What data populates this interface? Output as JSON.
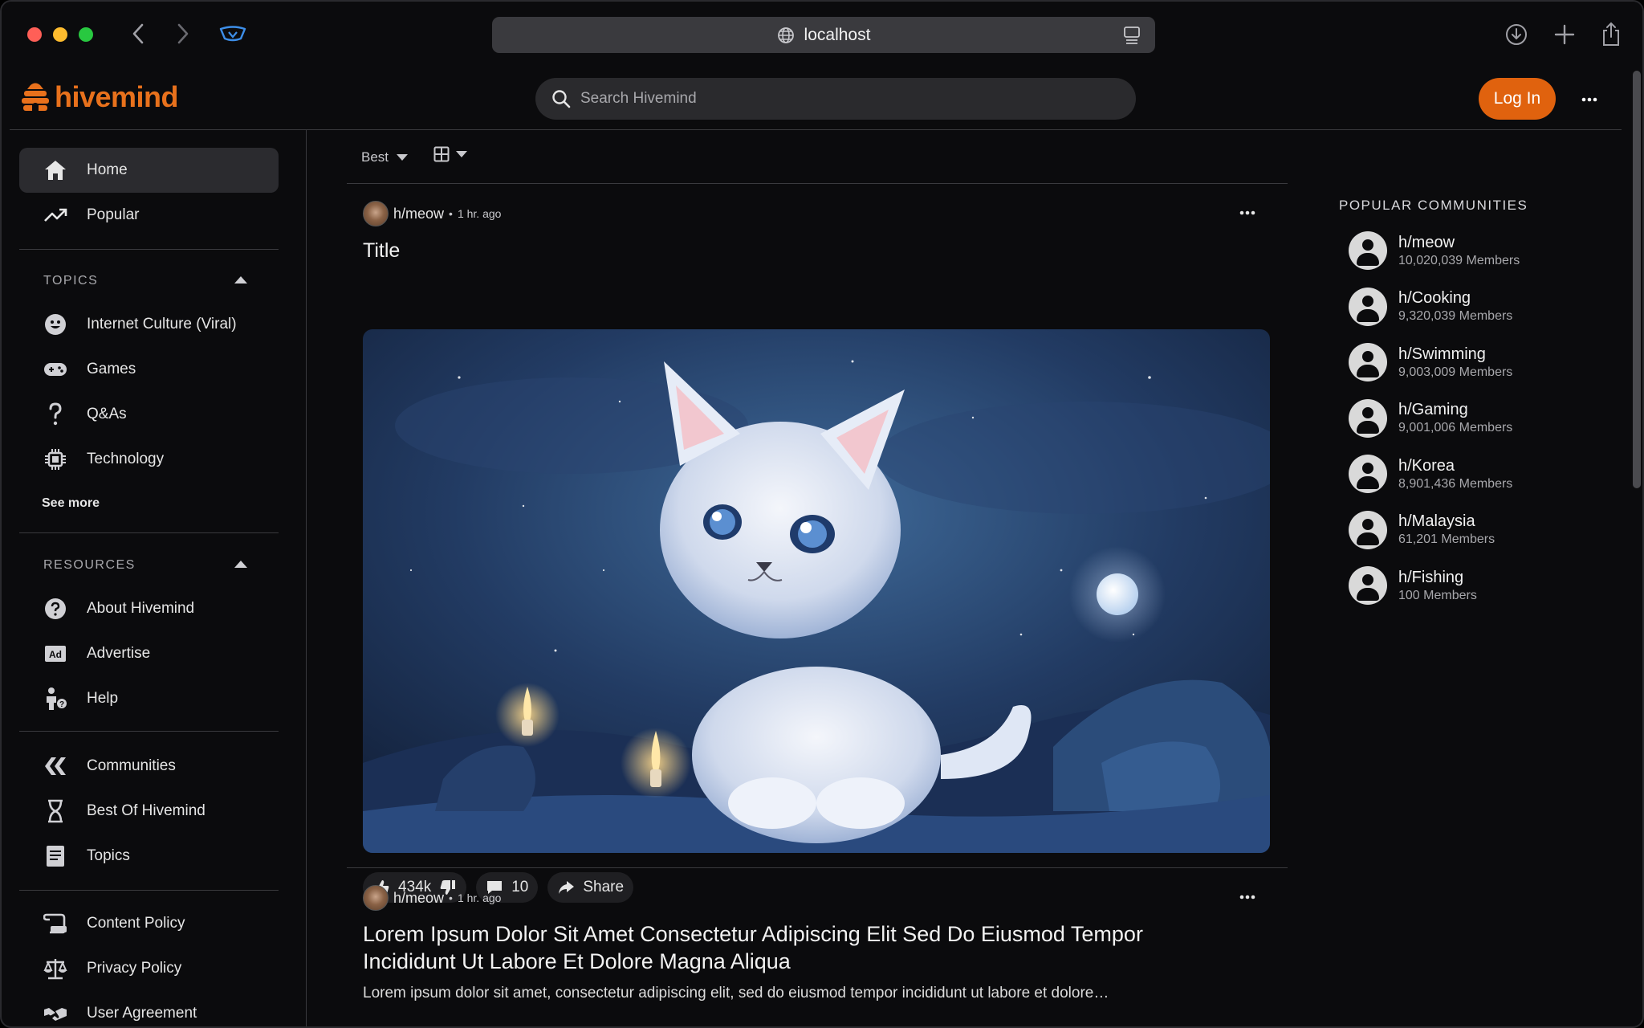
{
  "browser": {
    "url": "localhost"
  },
  "app": {
    "name": "hivemind"
  },
  "header": {
    "search_placeholder": "Search Hivemind",
    "login_label": "Log In"
  },
  "sidebar": {
    "main": [
      {
        "label": "Home",
        "icon": "home-icon"
      },
      {
        "label": "Popular",
        "icon": "trending-icon"
      }
    ],
    "topics_title": "TOPICS",
    "topics": [
      {
        "label": "Internet Culture (Viral)",
        "icon": "smiley-icon"
      },
      {
        "label": "Games",
        "icon": "gamepad-icon"
      },
      {
        "label": "Q&As",
        "icon": "question-icon"
      },
      {
        "label": "Technology",
        "icon": "chip-icon"
      }
    ],
    "see_more": "See more",
    "resources_title": "RESOURCES",
    "resources": [
      {
        "label": "About Hivemind",
        "icon": "help-circle-icon"
      },
      {
        "label": "Advertise",
        "icon": "ad-icon"
      },
      {
        "label": "Help",
        "icon": "person-help-icon"
      }
    ],
    "browse": [
      {
        "label": "Communities",
        "icon": "communities-icon"
      },
      {
        "label": "Best Of Hivemind",
        "icon": "hourglass-icon"
      },
      {
        "label": "Topics",
        "icon": "book-icon"
      }
    ],
    "policies": [
      {
        "label": "Content Policy",
        "icon": "scroll-icon"
      },
      {
        "label": "Privacy Policy",
        "icon": "scale-icon"
      },
      {
        "label": "User Agreement",
        "icon": "handshake-icon"
      }
    ]
  },
  "feed": {
    "sort_label": "Best",
    "posts": [
      {
        "community": "h/meow",
        "time": "1 hr. ago",
        "title": "Title",
        "votes": "434k",
        "comments": "10",
        "share_label": "Share"
      },
      {
        "community": "h/meow",
        "time": "1 hr. ago",
        "title": "Lorem Ipsum Dolor Sit Amet Consectetur Adipiscing Elit Sed Do Eiusmod Tempor Incididunt Ut Labore Et Dolore Magna Aliqua",
        "excerpt": "Lorem ipsum dolor sit amet, consectetur adipiscing elit, sed do eiusmod tempor incididunt ut labore et dolore…"
      }
    ]
  },
  "right_panel": {
    "title": "POPULAR COMMUNITIES",
    "communities": [
      {
        "name": "h/meow",
        "members": "10,020,039 Members"
      },
      {
        "name": "h/Cooking",
        "members": "9,320,039 Members"
      },
      {
        "name": "h/Swimming",
        "members": "9,003,009 Members"
      },
      {
        "name": "h/Gaming",
        "members": "9,001,006 Members"
      },
      {
        "name": "h/Korea",
        "members": "8,901,436 Members"
      },
      {
        "name": "h/Malaysia",
        "members": "61,201 Members"
      },
      {
        "name": "h/Fishing",
        "members": "100 Members"
      }
    ]
  },
  "colors": {
    "accent": "#e0620e",
    "logo": "#e8711c",
    "background": "#0b0b0d"
  }
}
